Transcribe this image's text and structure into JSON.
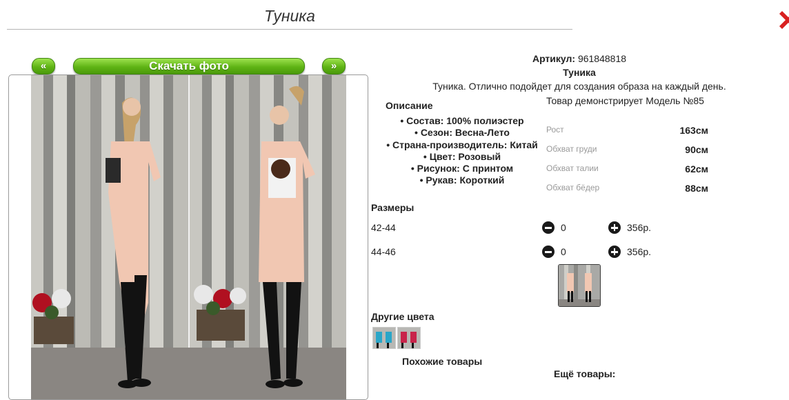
{
  "page": {
    "title": "Туника"
  },
  "gallery": {
    "prev_label": "«",
    "next_label": "»",
    "download_label": "Скачать фото"
  },
  "product": {
    "article_label": "Артикул:",
    "article_value": "961848818",
    "name": "Туника",
    "summary": "Туника. Отлично подойдет для создания образа на каждый день."
  },
  "description": {
    "heading": "Описание",
    "items": [
      "• Состав: 100% полиэстер",
      "• Сезон: Весна-Лето",
      "• Страна-производитель: Китай",
      "• Цвет: Розовый",
      "• Рисунок: С принтом",
      "• Рукав: Короткий"
    ]
  },
  "model": {
    "caption": "Товар демонстрирует Модель №85",
    "measurements": [
      {
        "label": "Рост",
        "value": "163см"
      },
      {
        "label": "Обхват груди",
        "value": "90см"
      },
      {
        "label": "Обхват талии",
        "value": "62см"
      },
      {
        "label": "Обхват бёдер",
        "value": "88см"
      }
    ]
  },
  "sizes": {
    "heading": "Размеры",
    "rows": [
      {
        "size": "42-44",
        "qty": "0",
        "price": "356р."
      },
      {
        "size": "44-46",
        "qty": "0",
        "price": "356р."
      }
    ]
  },
  "other_colors": {
    "heading": "Другие цвета"
  },
  "similar": {
    "heading": "Похожие товары"
  },
  "more": {
    "heading": "Ещё товары:"
  },
  "colors": {
    "button_green": "#5fb315",
    "close_red": "#d92020"
  },
  "icons": {
    "minus": "minus-circle-icon",
    "plus": "plus-circle-icon",
    "close": "close-icon"
  }
}
